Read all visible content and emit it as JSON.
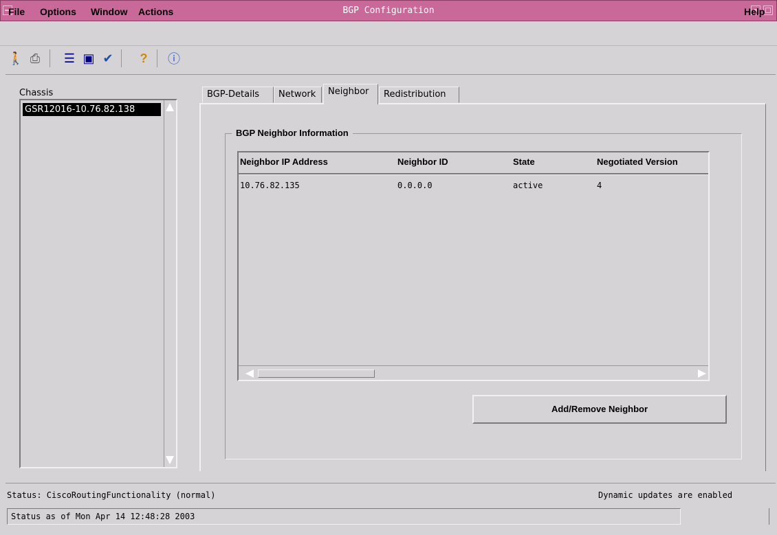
{
  "window": {
    "title": "BGP Configuration"
  },
  "menu": {
    "file": "File",
    "options": "Options",
    "window": "Window",
    "actions": "Actions",
    "help": "Help"
  },
  "toolbar": {
    "icons": [
      "exit-icon",
      "print-icon",
      "list-icon",
      "display-icon",
      "check-icon",
      "help-icon",
      "info-icon"
    ]
  },
  "sidebar": {
    "label": "Chassis",
    "selected_item": "GSR12016-10.76.82.138"
  },
  "tabs": [
    "BGP-Details",
    "Network",
    "Neighbor",
    "Redistribution"
  ],
  "active_tab": "Neighbor",
  "group": {
    "title": "BGP Neighbor Information",
    "columns": [
      "Neighbor IP Address",
      "Neighbor ID",
      "State",
      "Negotiated Version"
    ],
    "rows": [
      [
        "10.76.82.135",
        "0.0.0.0",
        "active",
        "4"
      ]
    ],
    "button": "Add/Remove Neighbor"
  },
  "status": {
    "left": "Status: CiscoRoutingFunctionality (normal)",
    "right": "Dynamic updates are enabled",
    "timestamp": "Status as of Mon Apr 14 12:48:28 2003"
  },
  "colors": {
    "titlebar": "#c8699a",
    "window_bg": "#d6d3d6",
    "selection": "#000000"
  }
}
